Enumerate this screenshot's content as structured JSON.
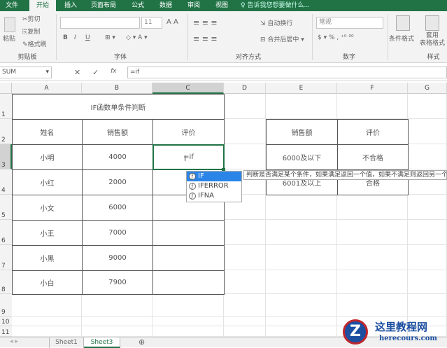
{
  "ribbon_tabs": [
    "文件",
    "开始",
    "插入",
    "页面布局",
    "公式",
    "数据",
    "审阅",
    "视图"
  ],
  "tell_me": "告诉我您想要做什么...",
  "clipboard": {
    "paste": "粘贴",
    "cut": "剪切",
    "copy": "复制",
    "format_painter": "格式刷",
    "group": "剪贴板"
  },
  "font": {
    "size": "11",
    "bold": "B",
    "italic": "I",
    "underline": "U",
    "group": "字体"
  },
  "alignment": {
    "wrap": "自动换行",
    "merge": "合并后居中",
    "group": "对齐方式"
  },
  "number": {
    "format": "常规",
    "percent": "%",
    "comma": ",",
    "group": "数字"
  },
  "styles": {
    "conditional": "条件格式",
    "table_format": "套用\n表格格式",
    "group": "样式"
  },
  "formula_bar": {
    "name_box": "SUM",
    "formula": "=if",
    "fx": "fx"
  },
  "columns": [
    "A",
    "B",
    "C",
    "D",
    "E",
    "F",
    "G"
  ],
  "rows": [
    "1",
    "2",
    "3",
    "4",
    "5",
    "6",
    "7",
    "8",
    "9",
    "10",
    "11"
  ],
  "table1": {
    "title": "IF函数单条件判断",
    "headers": [
      "姓名",
      "销售额",
      "评价"
    ],
    "rows": [
      [
        "小明",
        "4000",
        "=if"
      ],
      [
        "小红",
        "2000",
        ""
      ],
      [
        "小文",
        "6000",
        ""
      ],
      [
        "小王",
        "7000",
        ""
      ],
      [
        "小黑",
        "9000",
        ""
      ],
      [
        "小白",
        "7900",
        ""
      ]
    ]
  },
  "table2": {
    "headers": [
      "销售额",
      "评价"
    ],
    "rows": [
      [
        "6000及以下",
        "不合格"
      ],
      [
        "6001及以上",
        "合格"
      ]
    ]
  },
  "autocomplete": [
    "IF",
    "IFERROR",
    "IFNA"
  ],
  "tooltip": "判断是否满足某个条件，如果满足返回一个值，如果不满足则返回另一个值",
  "sheets": [
    "Sheet1",
    "Sheet3"
  ],
  "watermark": {
    "title": "这里教程网",
    "url": "herecours.com"
  }
}
